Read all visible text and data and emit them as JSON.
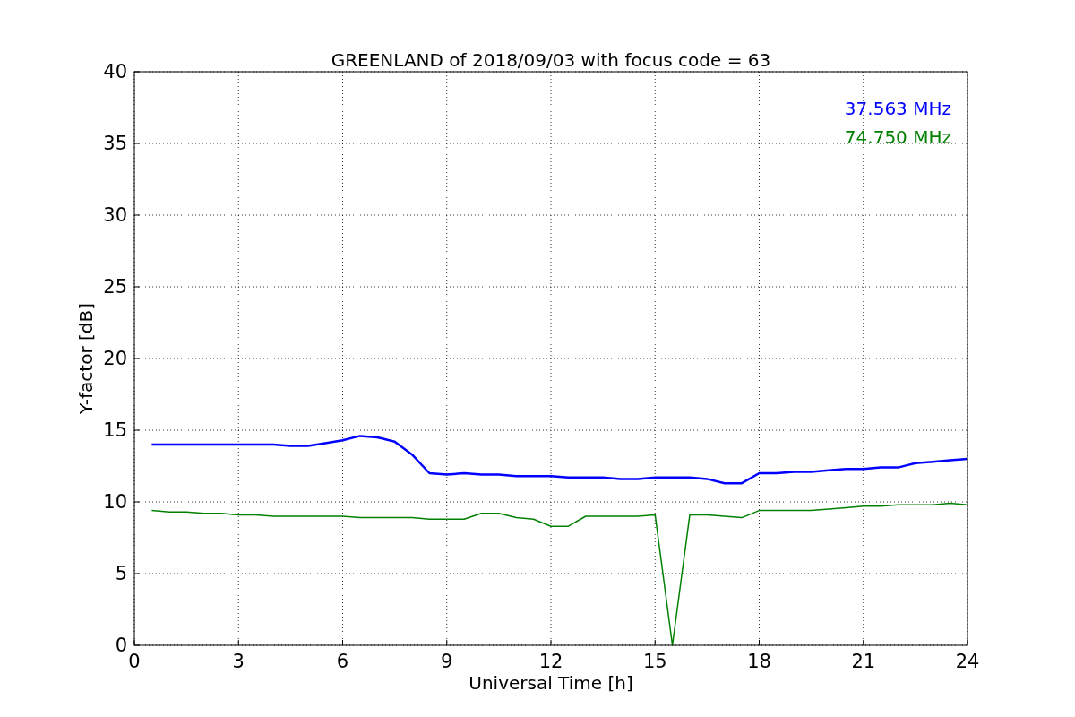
{
  "chart_data": {
    "type": "line",
    "title": "GREENLAND of 2018/09/03 with focus code = 63",
    "xlabel": "Universal Time [h]",
    "ylabel": "Y-factor [dB]",
    "x": [
      0.5,
      1,
      1.5,
      2,
      2.5,
      3,
      3.5,
      4,
      4.5,
      5,
      5.5,
      6,
      6.5,
      7,
      7.5,
      8,
      8.5,
      9,
      9.5,
      10,
      10.5,
      11,
      11.5,
      12,
      12.5,
      13,
      13.5,
      14,
      14.5,
      15,
      15.5,
      16,
      16.5,
      17,
      17.5,
      18,
      18.5,
      19,
      19.5,
      20,
      20.5,
      21,
      21.5,
      22,
      22.5,
      23,
      23.5,
      24
    ],
    "series": [
      {
        "name": "37.563 MHz",
        "color": "#0000ff",
        "values": [
          14.0,
          14.0,
          14.0,
          14.0,
          14.0,
          14.0,
          14.0,
          14.0,
          13.9,
          13.9,
          14.1,
          14.3,
          14.6,
          14.5,
          14.2,
          13.3,
          12.0,
          11.9,
          12.0,
          11.9,
          11.9,
          11.8,
          11.8,
          11.8,
          11.7,
          11.7,
          11.7,
          11.6,
          11.6,
          11.7,
          11.7,
          11.7,
          11.6,
          11.3,
          11.3,
          12.0,
          12.0,
          12.1,
          12.1,
          12.2,
          12.3,
          12.3,
          12.4,
          12.4,
          12.7,
          12.8,
          12.9,
          13.0
        ]
      },
      {
        "name": "74.750 MHz",
        "color": "#008000",
        "values": [
          9.4,
          9.3,
          9.3,
          9.2,
          9.2,
          9.1,
          9.1,
          9.0,
          9.0,
          9.0,
          9.0,
          9.0,
          8.9,
          8.9,
          8.9,
          8.9,
          8.8,
          8.8,
          8.8,
          9.2,
          9.2,
          8.9,
          8.8,
          8.3,
          8.3,
          9.0,
          9.0,
          9.0,
          9.0,
          9.1,
          0,
          9.1,
          9.1,
          9.0,
          8.9,
          9.4,
          9.4,
          9.4,
          9.4,
          9.5,
          9.6,
          9.7,
          9.7,
          9.8,
          9.8,
          9.8,
          9.9,
          9.8
        ]
      }
    ],
    "xlim": [
      0,
      24
    ],
    "ylim": [
      0,
      40
    ],
    "xticks": [
      0,
      3,
      6,
      9,
      12,
      15,
      18,
      21,
      24
    ],
    "yticks": [
      0,
      5,
      10,
      15,
      20,
      25,
      30,
      35,
      40
    ],
    "grid": true
  }
}
